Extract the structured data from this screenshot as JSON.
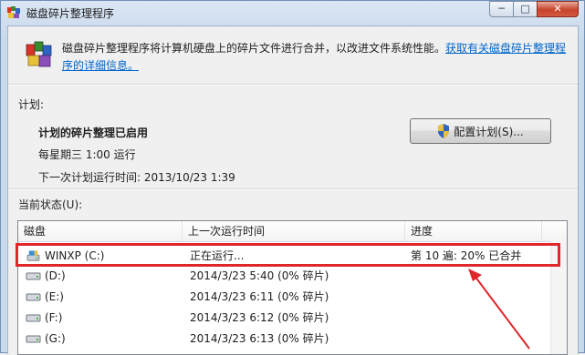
{
  "window": {
    "title": "磁盘碎片整理程序",
    "min_glyph": "─",
    "max_glyph": "□",
    "close_glyph": "✕"
  },
  "intro": {
    "text": "磁盘碎片整理程序将计算机硬盘上的碎片文件进行合并，以改进文件系统性能。",
    "link": "获取有关磁盘碎片整理程序的详细信息。"
  },
  "schedule": {
    "section_label": "计划:",
    "status": "计划的碎片整理已启用",
    "frequency": "每星期三  1:00 运行",
    "next_run": "下一次计划运行时间: 2013/10/23 1:39",
    "configure_button": "配置计划(S)..."
  },
  "current_status": {
    "section_label": "当前状态(U):",
    "columns": [
      "磁盘",
      "上一次运行时间",
      "进度"
    ],
    "rows": [
      {
        "disk": "WINXP (C:)",
        "last_run": "正在运行...",
        "progress": "第 10 遍: 20% 已合并",
        "selected": true,
        "icon": "system-drive-icon"
      },
      {
        "disk": "(D:)",
        "last_run": "2014/3/23 5:40 (0% 碎片)",
        "progress": "",
        "icon": "drive-icon"
      },
      {
        "disk": "(E:)",
        "last_run": "2014/3/23 6:11 (0% 碎片)",
        "progress": "",
        "icon": "drive-icon"
      },
      {
        "disk": "(F:)",
        "last_run": "2014/3/23 6:12 (0% 碎片)",
        "progress": "",
        "icon": "drive-icon"
      },
      {
        "disk": "(G:)",
        "last_run": "2014/3/23 6:13 (0% 碎片)",
        "progress": "",
        "icon": "drive-icon"
      }
    ]
  },
  "annotation": {
    "highlight_color": "#e0262b"
  }
}
